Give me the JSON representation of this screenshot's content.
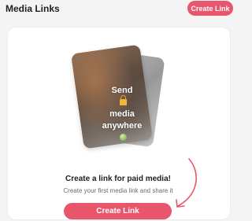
{
  "header": {
    "title": "Media Links",
    "create_button_label": "Create Link"
  },
  "illustration": {
    "line1": "Send",
    "line2": "media",
    "line3": "anywhere",
    "icons": [
      "lock-icon",
      "globe-icon"
    ]
  },
  "empty_state": {
    "heading": "Create a link for paid media!",
    "subtext": "Create your first media link and share it",
    "cta_label": "Create Link"
  },
  "colors": {
    "accent": "#e8566c",
    "background": "#f4f4f5",
    "card": "#ffffff"
  }
}
